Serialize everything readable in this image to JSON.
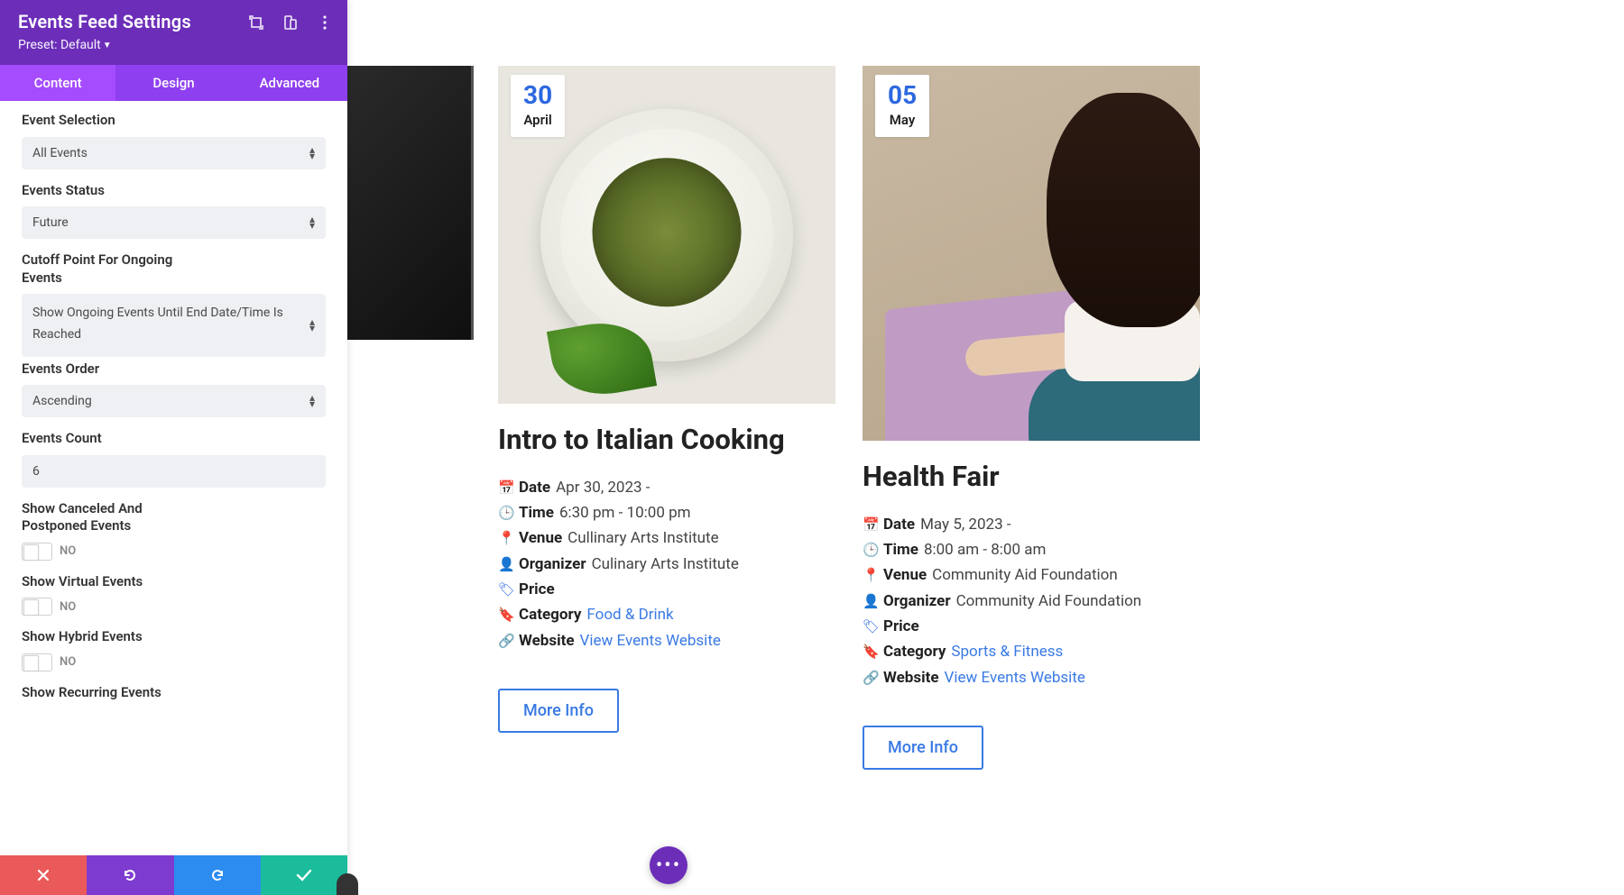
{
  "sidebar": {
    "title": "Events Feed Settings",
    "preset_label": "Preset: Default",
    "tabs": {
      "content": "Content",
      "design": "Design",
      "advanced": "Advanced"
    },
    "fields": {
      "event_selection": {
        "label": "Event Selection",
        "value": "All Events"
      },
      "events_status": {
        "label": "Events Status",
        "value": "Future"
      },
      "cutoff": {
        "label": "Cutoff Point For Ongoing Events",
        "value": "Show Ongoing Events Until End Date/Time Is Reached"
      },
      "events_order": {
        "label": "Events Order",
        "value": "Ascending"
      },
      "events_count": {
        "label": "Events Count",
        "value": "6"
      },
      "show_canceled": {
        "label": "Show Canceled And Postponed Events",
        "value": "NO"
      },
      "show_virtual": {
        "label": "Show Virtual Events",
        "value": "NO"
      },
      "show_hybrid": {
        "label": "Show Hybrid Events",
        "value": "NO"
      },
      "show_recurring": {
        "label": "Show Recurring Events"
      }
    }
  },
  "labels": {
    "date": "Date",
    "time": "Time",
    "venue": "Venue",
    "organizer": "Organizer",
    "price": "Price",
    "category": "Category",
    "website": "Website",
    "view_website": "View Events Website",
    "more_info": "More Info"
  },
  "cards": [
    {
      "badge_day": "30",
      "badge_month": "April",
      "title": "Intro to Italian Cooking",
      "date": "Apr 30, 2023 -",
      "time": "6:30 pm - 10:00 pm",
      "venue": "Cullinary Arts Institute",
      "organizer": "Culinary Arts Institute",
      "price": "",
      "category": "Food & Drink"
    },
    {
      "badge_day": "05",
      "badge_month": "May",
      "title": "Health Fair",
      "date": "May 5, 2023 -",
      "time": "8:00 am - 8:00 am",
      "venue": "Community Aid Foundation",
      "organizer": "Community Aid Foundation",
      "price": "",
      "category": "Sports & Fitness"
    }
  ]
}
